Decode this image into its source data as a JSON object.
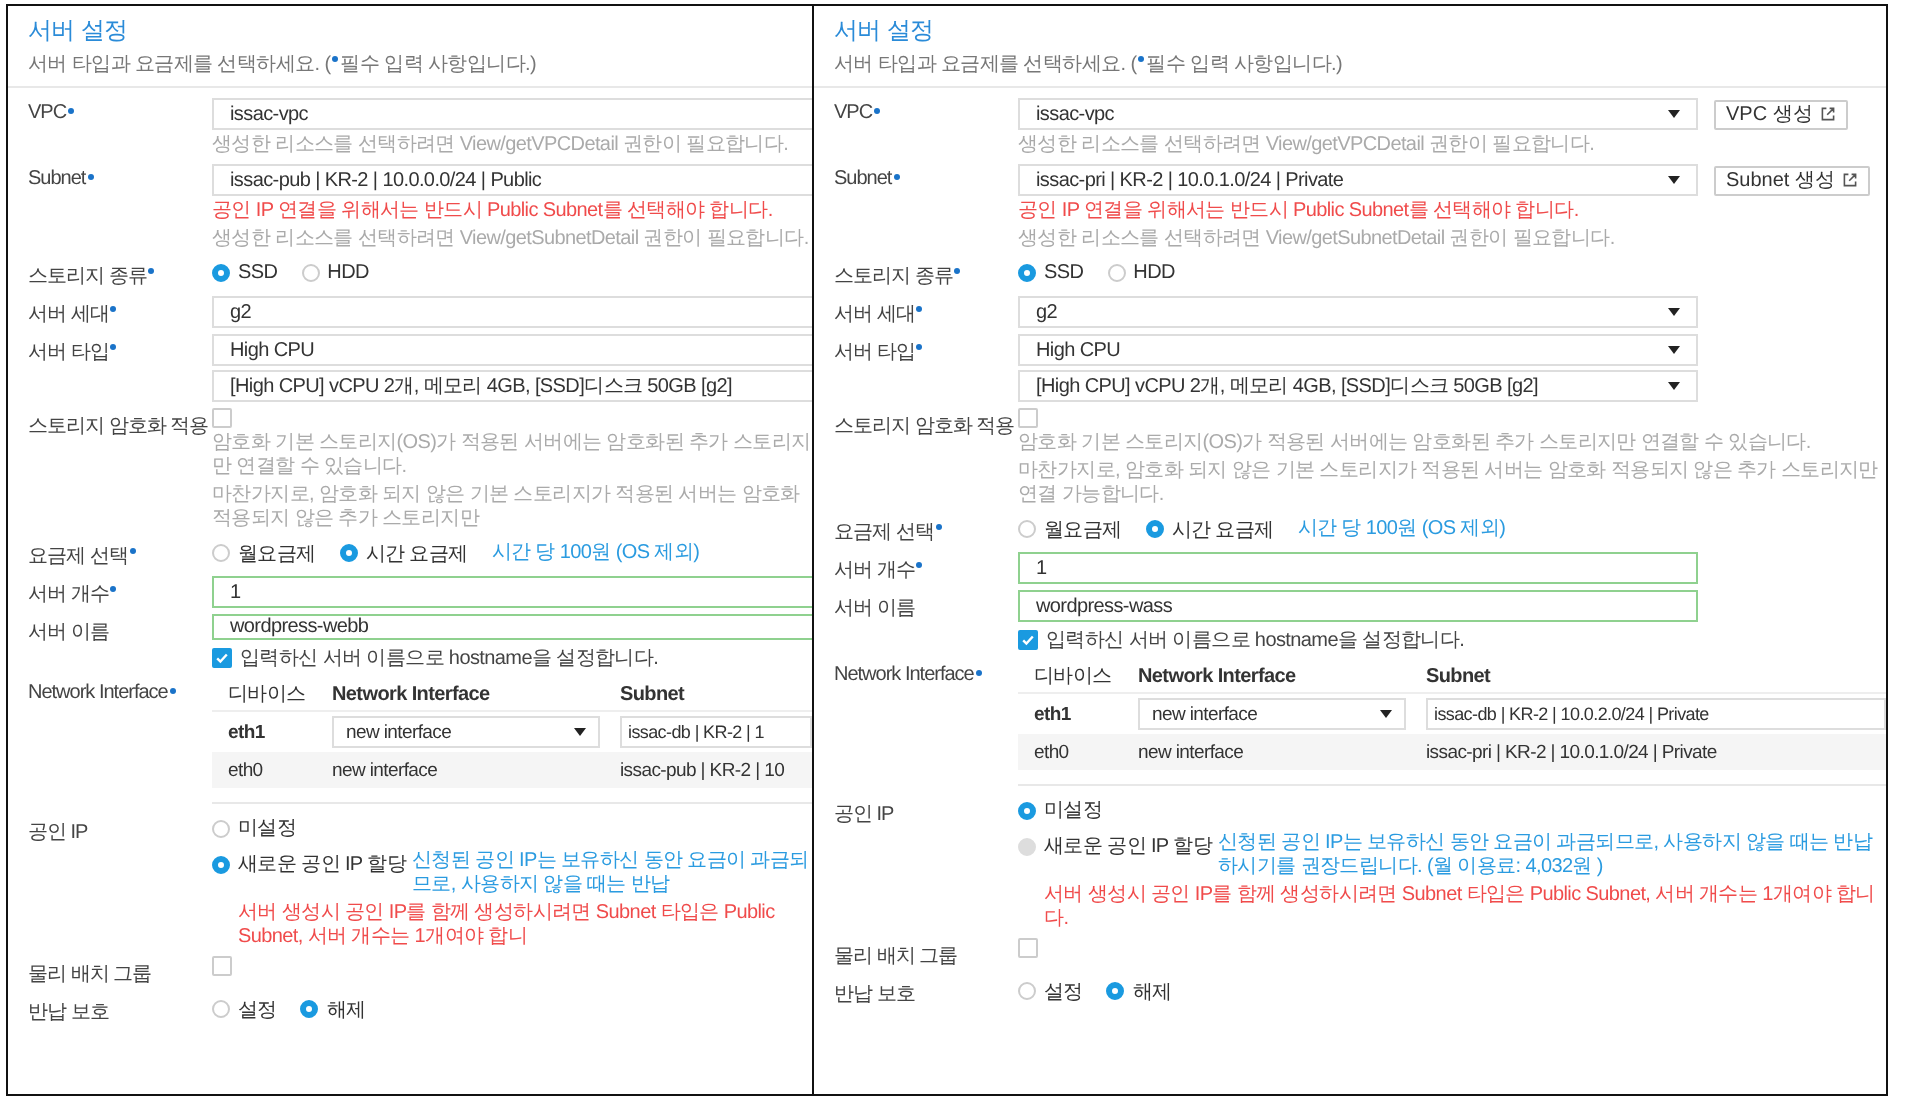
{
  "panels": [
    {
      "cropped": true,
      "title": "서버 설정",
      "subtitle": [
        "서버 타입과 요금제를 선택하세요. (",
        "필수 입력 사항입니다.)"
      ],
      "rows": [
        {
          "label": "VPC",
          "required": true,
          "blocks": [
            {
              "kind": "select",
              "value": "issac-vpc"
            },
            {
              "kind": "note",
              "text": "생성한 리소스를 선택하려면 View/getVPCDetail 권한이 필요합니다."
            }
          ]
        },
        {
          "label": "Subnet",
          "required": true,
          "blocks": [
            {
              "kind": "select",
              "value": "issac-pub | KR-2 | 10.0.0.0/24 | Public"
            },
            {
              "kind": "warning",
              "text": "공인 IP 연결을 위해서는 반드시 Public Subnet를 선택해야 합니다."
            },
            {
              "kind": "note",
              "text": "생성한 리소스를 선택하려면 View/getSubnetDetail 권한이 필요합니다."
            }
          ]
        },
        {
          "label": "스토리지 종류",
          "required": true,
          "blocks": [
            {
              "kind": "radio-row",
              "options": [
                {
                  "label": "SSD",
                  "selected": true,
                  "disabled": false
                },
                {
                  "label": "HDD",
                  "selected": false,
                  "disabled": false
                }
              ]
            }
          ]
        },
        {
          "label": "서버 세대",
          "required": true,
          "blocks": [
            {
              "kind": "select",
              "value": "g2"
            }
          ]
        },
        {
          "label": "서버 타입",
          "required": true,
          "blocks": [
            {
              "kind": "select",
              "value": "High CPU"
            },
            {
              "kind": "select",
              "value": "[High CPU] vCPU 2개, 메모리 4GB, [SSD]디스크 50GB [g2]"
            }
          ]
        },
        {
          "label": "스토리지 암호화 적용",
          "required": false,
          "blocks": [
            {
              "kind": "checkbox",
              "checked": false
            },
            {
              "kind": "note",
              "text": "암호화 기본 스토리지(OS)가 적용된 서버에는 암호화된 추가 스토리지만 연결할 수 있습니다."
            },
            {
              "kind": "note",
              "text": "마찬가지로, 암호화 되지 않은 기본 스토리지가 적용된 서버는 암호화 적용되지 않은 추가 스토리지만"
            }
          ]
        },
        {
          "label": "요금제 선택",
          "required": true,
          "blocks": [
            {
              "kind": "radio-row",
              "note": "시간 당 100원 (OS 제외)",
              "options": [
                {
                  "label": "월요금제",
                  "selected": false,
                  "disabled": false
                },
                {
                  "label": "시간 요금제",
                  "selected": true,
                  "disabled": false
                }
              ]
            }
          ]
        },
        {
          "label": "서버 개수",
          "required": true,
          "blocks": [
            {
              "kind": "input",
              "value": "1",
              "valid": true
            }
          ]
        },
        {
          "label": "서버 이름",
          "required": false,
          "blocks": [
            {
              "kind": "input",
              "value": "wordpress-webb",
              "valid": true
            },
            {
              "kind": "checkbox",
              "checked": true,
              "text": "입력하신 서버 이름으로 hostname을 설정합니다."
            }
          ]
        },
        {
          "label": "Network Interface",
          "required": true,
          "blocks": [
            {
              "kind": "table",
              "columns": [
                "디바이스",
                "Network Interface",
                "Subnet"
              ],
              "rows": [
                {
                  "kind": "editable",
                  "device": "eth1",
                  "interface": "new interface",
                  "subnet": "issac-db | KR-2 | 1"
                },
                {
                  "kind": "fixed",
                  "device": "eth0",
                  "interface": "new interface",
                  "subnet": "issac-pub | KR-2 | 10"
                }
              ]
            }
          ]
        },
        {
          "label": "공인 IP",
          "required": false,
          "blocks": [
            {
              "kind": "radio-list",
              "options": [
                {
                  "label": "미설정",
                  "selected": false,
                  "disabled": false
                },
                {
                  "label": "새로운 공인 IP 할당",
                  "selected": true,
                  "disabled": false,
                  "note": "신청된 공인 IP는 보유하신 동안 요금이 과금되므로, 사용하지 않을 때는 반납"
                }
              ]
            },
            {
              "kind": "warning",
              "text": "서버 생성시 공인 IP를 함께 생성하시려면 Subnet 타입은 Public Subnet, 서버 개수는 1개여야 합니"
            }
          ]
        },
        {
          "label": "물리 배치 그룹",
          "required": false,
          "blocks": [
            {
              "kind": "checkbox",
              "checked": false
            }
          ]
        },
        {
          "label": "반납 보호",
          "required": false,
          "blocks": [
            {
              "kind": "radio-row",
              "options": [
                {
                  "label": "설정",
                  "selected": false,
                  "disabled": false
                },
                {
                  "label": "해제",
                  "selected": true,
                  "disabled": false
                }
              ]
            }
          ]
        }
      ]
    },
    {
      "cropped": false,
      "title": "서버 설정",
      "subtitle": [
        "서버 타입과 요금제를 선택하세요. (",
        "필수 입력 사항입니다.)"
      ],
      "rows": [
        {
          "label": "VPC",
          "required": true,
          "blocks": [
            {
              "kind": "select",
              "value": "issac-vpc",
              "button": "VPC 생성"
            },
            {
              "kind": "note",
              "text": "생성한 리소스를 선택하려면 View/getVPCDetail 권한이 필요합니다."
            }
          ]
        },
        {
          "label": "Subnet",
          "required": true,
          "blocks": [
            {
              "kind": "select",
              "value": "issac-pri | KR-2 | 10.0.1.0/24 | Private",
              "button": "Subnet 생성"
            },
            {
              "kind": "warning",
              "text": "공인 IP 연결을 위해서는 반드시 Public Subnet를 선택해야 합니다."
            },
            {
              "kind": "note",
              "text": "생성한 리소스를 선택하려면 View/getSubnetDetail 권한이 필요합니다."
            }
          ]
        },
        {
          "label": "스토리지 종류",
          "required": true,
          "blocks": [
            {
              "kind": "radio-row",
              "options": [
                {
                  "label": "SSD",
                  "selected": true,
                  "disabled": false
                },
                {
                  "label": "HDD",
                  "selected": false,
                  "disabled": false
                }
              ]
            }
          ]
        },
        {
          "label": "서버 세대",
          "required": true,
          "blocks": [
            {
              "kind": "select",
              "value": "g2"
            }
          ]
        },
        {
          "label": "서버 타입",
          "required": true,
          "blocks": [
            {
              "kind": "select",
              "value": "High CPU"
            },
            {
              "kind": "select",
              "value": "[High CPU] vCPU 2개, 메모리 4GB, [SSD]디스크 50GB [g2]"
            }
          ]
        },
        {
          "label": "스토리지 암호화 적용",
          "required": false,
          "blocks": [
            {
              "kind": "checkbox",
              "checked": false
            },
            {
              "kind": "note",
              "text": "암호화 기본 스토리지(OS)가 적용된 서버에는 암호화된 추가 스토리지만 연결할 수 있습니다."
            },
            {
              "kind": "note",
              "text": "마찬가지로, 암호화 되지 않은 기본 스토리지가 적용된 서버는 암호화 적용되지 않은 추가 스토리지만 연결 가능합니다."
            }
          ]
        },
        {
          "label": "요금제 선택",
          "required": true,
          "blocks": [
            {
              "kind": "radio-row",
              "note": "시간 당 100원 (OS 제외)",
              "options": [
                {
                  "label": "월요금제",
                  "selected": false,
                  "disabled": false
                },
                {
                  "label": "시간 요금제",
                  "selected": true,
                  "disabled": false
                }
              ]
            }
          ]
        },
        {
          "label": "서버 개수",
          "required": true,
          "blocks": [
            {
              "kind": "input",
              "value": "1",
              "valid": true
            }
          ]
        },
        {
          "label": "서버 이름",
          "required": false,
          "blocks": [
            {
              "kind": "input",
              "value": "wordpress-wass",
              "valid": true
            },
            {
              "kind": "checkbox",
              "checked": true,
              "text": "입력하신 서버 이름으로 hostname을 설정합니다."
            }
          ]
        },
        {
          "label": "Network Interface",
          "required": true,
          "blocks": [
            {
              "kind": "table",
              "columns": [
                "디바이스",
                "Network Interface",
                "Subnet"
              ],
              "rows": [
                {
                  "kind": "editable",
                  "device": "eth1",
                  "interface": "new interface",
                  "subnet": "issac-db | KR-2 | 10.0.2.0/24 | Private"
                },
                {
                  "kind": "fixed",
                  "device": "eth0",
                  "interface": "new interface",
                  "subnet": "issac-pri | KR-2 | 10.0.1.0/24 | Private"
                }
              ]
            }
          ]
        },
        {
          "label": "공인 IP",
          "required": false,
          "blocks": [
            {
              "kind": "radio-list",
              "options": [
                {
                  "label": "미설정",
                  "selected": true,
                  "disabled": false
                },
                {
                  "label": "새로운 공인 IP 할당",
                  "selected": false,
                  "disabled": true,
                  "note": "신청된 공인 IP는 보유하신 동안 요금이 과금되므로, 사용하지 않을 때는 반납하시기를 권장드립니다. (월 이용료: 4,032원 )"
                }
              ]
            },
            {
              "kind": "warning",
              "text": "서버 생성시 공인 IP를 함께 생성하시려면 Subnet 타입은 Public Subnet, 서버 개수는 1개여야 합니다."
            }
          ]
        },
        {
          "label": "물리 배치 그룹",
          "required": false,
          "blocks": [
            {
              "kind": "checkbox",
              "checked": false
            }
          ]
        },
        {
          "label": "반납 보호",
          "required": false,
          "blocks": [
            {
              "kind": "radio-row",
              "options": [
                {
                  "label": "설정",
                  "selected": false,
                  "disabled": false
                },
                {
                  "label": "해제",
                  "selected": true,
                  "disabled": false
                }
              ]
            }
          ]
        }
      ]
    }
  ]
}
